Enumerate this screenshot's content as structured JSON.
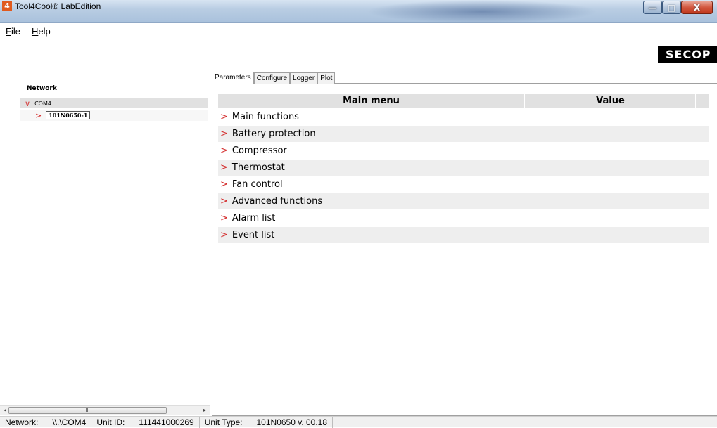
{
  "window": {
    "title": "Tool4Cool® LabEdition",
    "app_icon": "4",
    "buttons": {
      "minimize": "—",
      "maximize": "□",
      "close": "X"
    }
  },
  "menu": {
    "file": {
      "mnemonic": "F",
      "rest": "ile"
    },
    "help": {
      "mnemonic": "H",
      "rest": "elp"
    }
  },
  "logo": {
    "text": "SECOP"
  },
  "network": {
    "label": "Network",
    "port": "COM4",
    "device": "101N0650-1",
    "scroll_thumb_glyph": "III"
  },
  "tabs": [
    {
      "label": "Parameters",
      "active": true
    },
    {
      "label": "Configure",
      "active": false
    },
    {
      "label": "Logger",
      "active": false
    },
    {
      "label": "Plot",
      "active": false
    }
  ],
  "table": {
    "col_main": "Main menu",
    "col_value": "Value",
    "rows": [
      {
        "label": "Main functions",
        "value": ""
      },
      {
        "label": "Battery protection",
        "value": ""
      },
      {
        "label": "Compressor",
        "value": ""
      },
      {
        "label": "Thermostat",
        "value": ""
      },
      {
        "label": "Fan control",
        "value": ""
      },
      {
        "label": "Advanced functions",
        "value": ""
      },
      {
        "label": "Alarm list",
        "value": ""
      },
      {
        "label": "Event list",
        "value": ""
      }
    ]
  },
  "status": {
    "network_label": "Network:",
    "network_value": "\\\\.\\COM4",
    "unit_id_label": "Unit ID:",
    "unit_id_value": "111441000269",
    "unit_type_label": "Unit Type:",
    "unit_type_value": "101N0650 v. 00.18"
  },
  "colors": {
    "accent_chevron": "#d42a2a",
    "header_bg": "#e1e1e1",
    "row_alt_bg": "#eeeeee",
    "logo_bg": "#000000"
  }
}
